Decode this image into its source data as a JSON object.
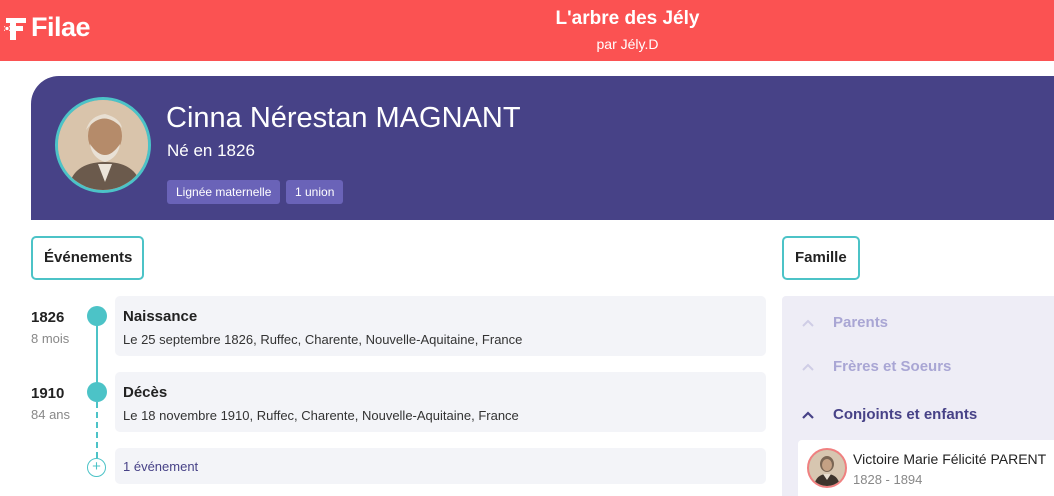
{
  "header": {
    "logo_text": "Filae",
    "tree_title": "L'arbre des Jély",
    "tree_author": "par Jély.D",
    "accent_color": "#fb5252"
  },
  "person": {
    "name": "Cinna Nérestan MAGNANT",
    "birth": "Né en 1826",
    "badges": [
      "Lignée maternelle",
      "1 union"
    ],
    "hero_color": "#474287"
  },
  "tabs": {
    "events": "Événements",
    "family": "Famille"
  },
  "events": [
    {
      "year": "1826",
      "age": "8 mois",
      "title": "Naissance",
      "detail": "Le 25 septembre 1826, Ruffec, Charente, Nouvelle-Aquitaine, France"
    },
    {
      "year": "1910",
      "age": "84 ans",
      "title": "Décès",
      "detail": "Le 18 novembre 1910, Ruffec, Charente, Nouvelle-Aquitaine, France"
    }
  ],
  "events_more": "1 événement",
  "family": {
    "sections": [
      "Parents",
      "Frères et Soeurs",
      "Conjoints et enfants"
    ],
    "spouse": {
      "name": "Victoire Marie Félicité PARENT",
      "dates": "1828 - 1894"
    }
  }
}
